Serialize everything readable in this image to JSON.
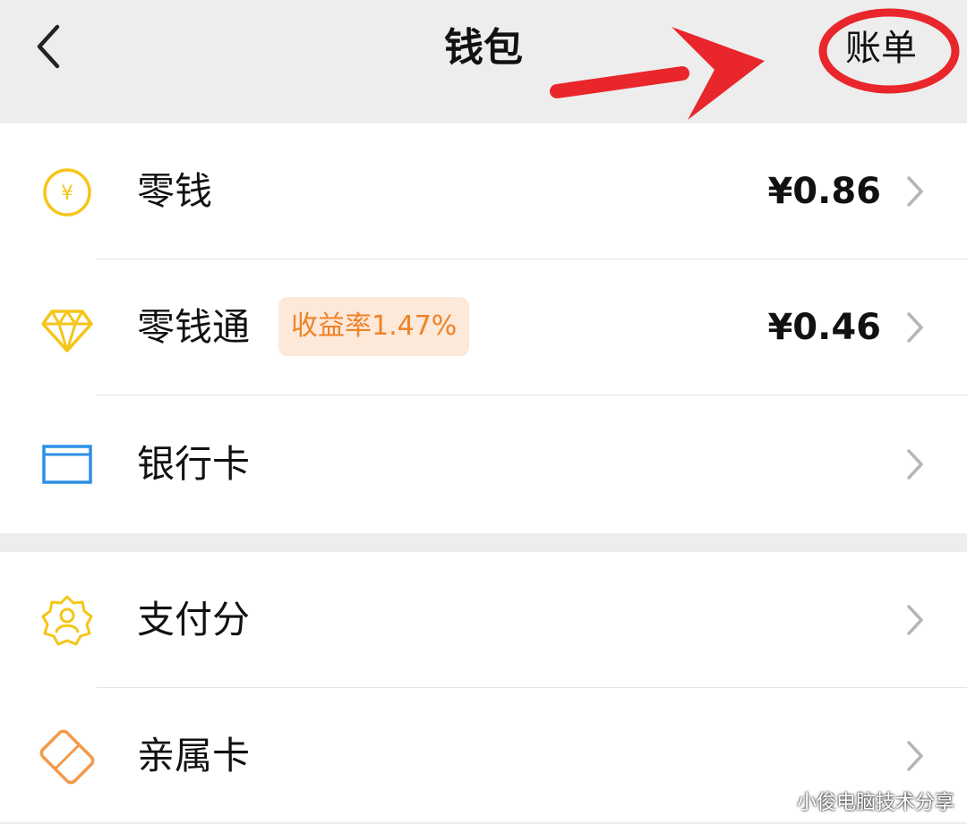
{
  "header": {
    "title": "钱包",
    "bill_label": "账单"
  },
  "group1": {
    "items": [
      {
        "label": "零钱",
        "amount": "¥0.86",
        "icon": "yuan-coin-icon"
      },
      {
        "label": "零钱通",
        "badge": "收益率1.47%",
        "amount": "¥0.46",
        "icon": "diamond-icon"
      },
      {
        "label": "银行卡",
        "icon": "bank-card-icon"
      }
    ]
  },
  "group2": {
    "items": [
      {
        "label": "支付分",
        "icon": "pay-score-icon"
      },
      {
        "label": "亲属卡",
        "icon": "family-card-icon"
      }
    ]
  },
  "watermark": "小俊电脑技术分享",
  "colors": {
    "yellow_icon": "#f5c518",
    "blue_icon": "#2d8fe5",
    "orange_icon": "#f39a4a",
    "badge_bg": "#fde9da",
    "badge_text": "#ee8228",
    "annotation_red": "#e8262b"
  }
}
